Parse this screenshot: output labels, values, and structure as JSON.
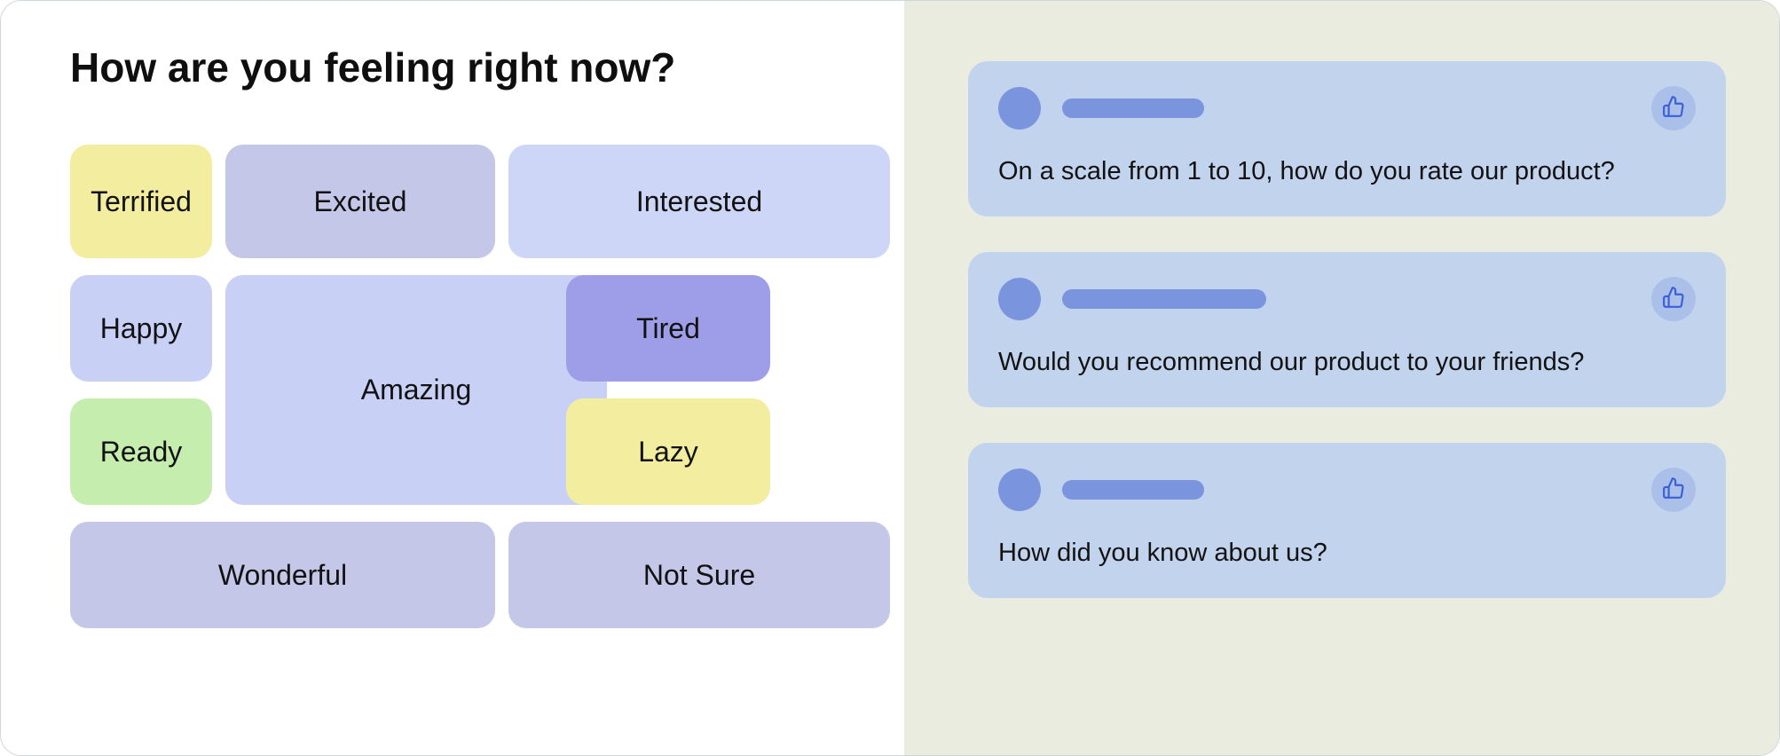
{
  "left": {
    "title": "How are you feeling right now?",
    "chips": {
      "terrified": "Terrified",
      "excited": "Excited",
      "interested": "Interested",
      "happy": "Happy",
      "amazing": "Amazing",
      "tired": "Tired",
      "ready": "Ready",
      "lazy": "Lazy",
      "wonderful": "Wonderful",
      "notsure": "Not Sure"
    }
  },
  "right": {
    "cards": [
      {
        "name_width": 160,
        "question": "On a scale from 1 to 10, how do you rate our product?"
      },
      {
        "name_width": 230,
        "question": "Would you recommend our product to your friends?"
      },
      {
        "name_width": 160,
        "question": "How did you know about us?"
      }
    ]
  },
  "colors": {
    "indigo_light": "#c8d1f5",
    "indigo_gray": "#c4c7e7",
    "indigo_mid": "#9d9de8",
    "yellow": "#f2ed9f",
    "green": "#c5edad",
    "blue_card": "#c2d3ee",
    "blue_accent": "#7a95dd",
    "right_bg": "#e9ecdf"
  }
}
